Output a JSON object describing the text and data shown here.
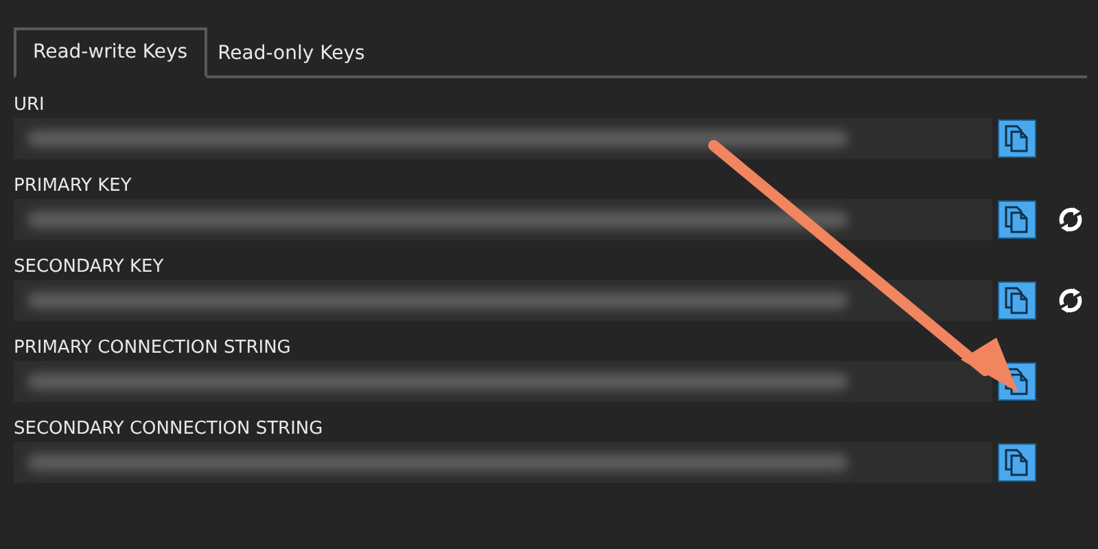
{
  "tabs": [
    {
      "label": "Read-write Keys",
      "selected": true
    },
    {
      "label": "Read-only Keys",
      "selected": false
    }
  ],
  "fields": [
    {
      "label": "URI",
      "regenerate": false
    },
    {
      "label": "PRIMARY KEY",
      "regenerate": true
    },
    {
      "label": "SECONDARY KEY",
      "regenerate": true
    },
    {
      "label": "PRIMARY CONNECTION STRING",
      "regenerate": false
    },
    {
      "label": "SECONDARY CONNECTION STRING",
      "regenerate": false
    }
  ],
  "annotation_arrow": true
}
